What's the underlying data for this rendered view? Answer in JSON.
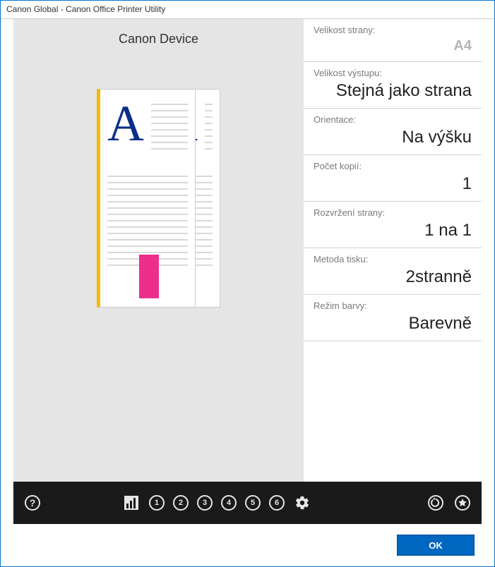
{
  "window": {
    "title": "Canon Global - Canon Office Printer Utility"
  },
  "preview": {
    "device_name": "Canon Device",
    "glyph": "A"
  },
  "settings": {
    "page_size": {
      "label": "Velikost strany:",
      "value": "A4"
    },
    "output_size": {
      "label": "Velikost výstupu:",
      "value": "Stejná jako strana"
    },
    "orientation": {
      "label": "Orientace:",
      "value": "Na výšku"
    },
    "copies": {
      "label": "Počet kopií:",
      "value": "1"
    },
    "layout": {
      "label": "Rozvržení strany:",
      "value": "1 na 1"
    },
    "print_method": {
      "label": "Metoda tisku:",
      "value": "2stranně"
    },
    "color_mode": {
      "label": "Režim barvy:",
      "value": "Barevně"
    }
  },
  "toolbar": {
    "presets": [
      "1",
      "2",
      "3",
      "4",
      "5",
      "6"
    ]
  },
  "footer": {
    "ok_label": "OK"
  }
}
